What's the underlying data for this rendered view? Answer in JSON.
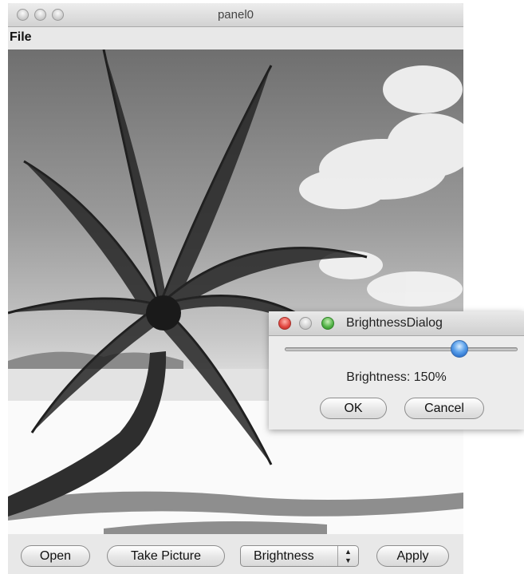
{
  "main_window": {
    "title": "panel0",
    "menu": [
      "File"
    ],
    "image": {
      "description_icon": "photo-palm-tree"
    },
    "toolbar": {
      "open_label": "Open",
      "take_picture_label": "Take Picture",
      "filter_select": {
        "selected": "Brightness"
      },
      "apply_label": "Apply"
    }
  },
  "brightness_dialog": {
    "title": "BrightnessDialog",
    "slider": {
      "value_fraction": 0.75
    },
    "value_text": "Brightness: 150%",
    "ok_label": "OK",
    "cancel_label": "Cancel"
  },
  "colors": {
    "close_red": "#e0443e",
    "zoom_green": "#4fb043",
    "slider_thumb_blue": "#3a85dc"
  }
}
